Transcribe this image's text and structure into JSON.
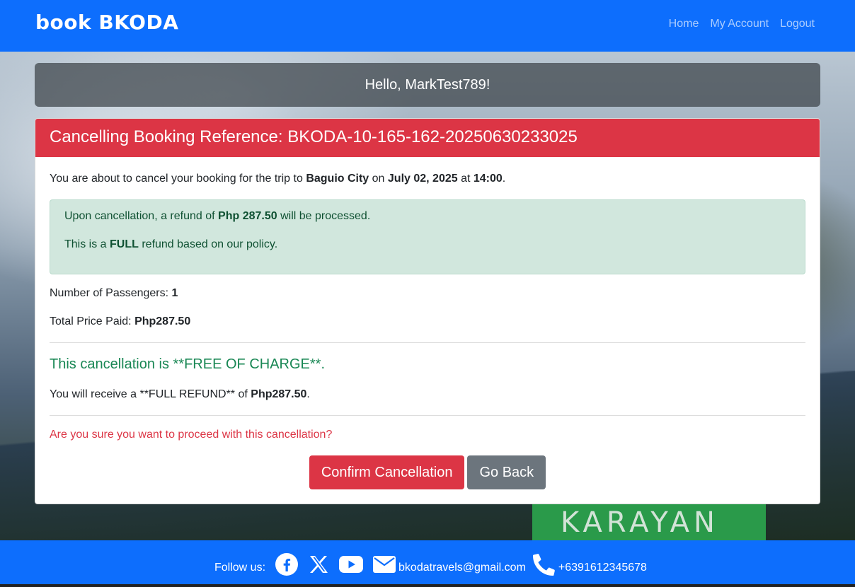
{
  "navbar": {
    "brand": "book BKODA",
    "links": [
      "Home",
      "My Account",
      "Logout"
    ]
  },
  "greeting": {
    "prefix": "Hello, ",
    "username": "MarkTest789",
    "suffix": "!"
  },
  "card": {
    "header": "Cancelling Booking Reference: BKODA-10-165-162-20250630233025",
    "intro": {
      "t1": "You are about to cancel your booking for the trip to ",
      "destination": "Baguio City",
      "t2": " on ",
      "date": "July 02, 2025",
      "t3": " at ",
      "time": "14:00",
      "t4": "."
    },
    "alert": {
      "line1_a": "Upon cancellation, a refund of ",
      "line1_amount": "Php 287.50",
      "line1_b": " will be processed.",
      "line2_a": "This is a ",
      "line2_type": "FULL",
      "line2_b": " refund based on our policy."
    },
    "passengers_label": "Number of Passengers: ",
    "passengers_value": "1",
    "total_label": "Total Price Paid: ",
    "total_value": "Php287.50",
    "free_text": "This cancellation is **FREE OF CHARGE**.",
    "receive_a": "You will receive a **FULL REFUND** of ",
    "receive_amount": "Php287.50",
    "receive_b": ".",
    "question": "Are you sure you want to proceed with this cancellation?",
    "confirm_label": "Confirm Cancellation",
    "back_label": "Go Back"
  },
  "footer": {
    "follow": "Follow us:",
    "email": "bkodatravels@gmail.com",
    "phone": "+6391612345678"
  },
  "colors": {
    "primary": "#0d6efd",
    "danger": "#dc3545",
    "success": "#198754",
    "secondary": "#6c757d"
  }
}
